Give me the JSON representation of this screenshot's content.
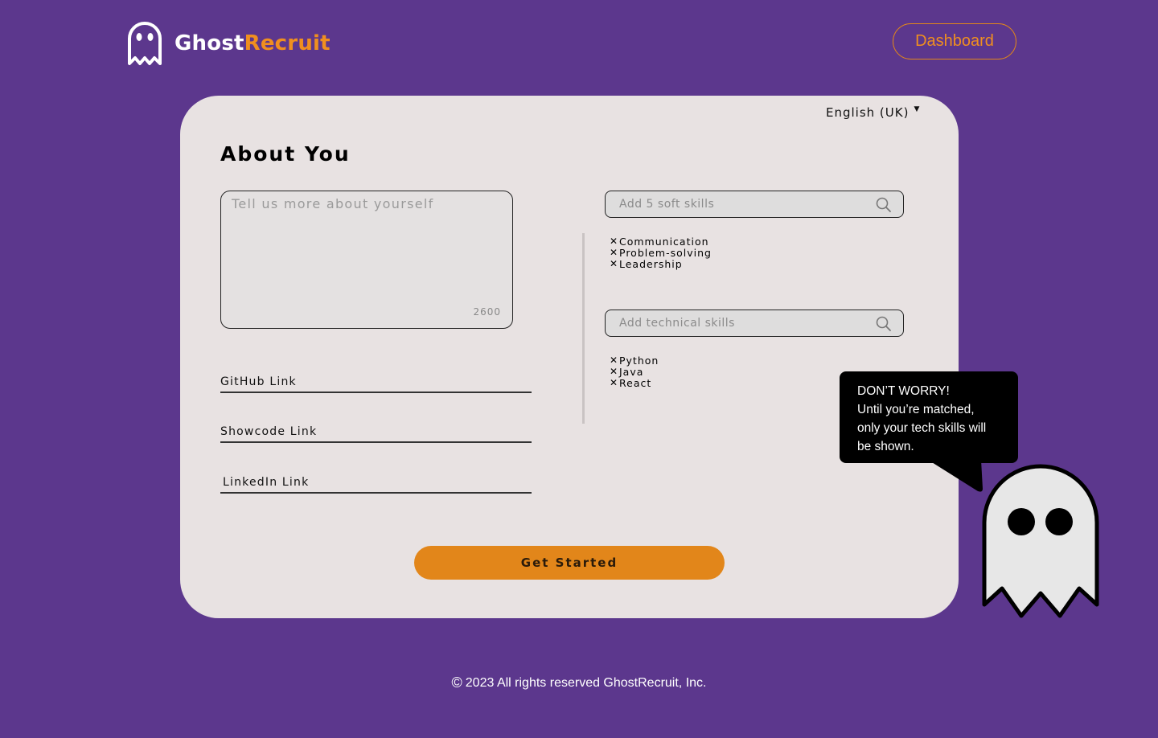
{
  "header": {
    "logo_word_1": "Ghost",
    "logo_word_2": "Recruit",
    "dashboard_label": "Dashboard"
  },
  "card": {
    "language": "English (UK)",
    "title": "About You",
    "about_placeholder": "Tell us more about yourself",
    "about_counter": "2600",
    "links": {
      "github": "GitHub Link",
      "showcode": "Showcode Link",
      "linkedin": "LinkedIn Link"
    },
    "soft_skills": {
      "placeholder": "Add 5 soft skills",
      "items": [
        "Communication",
        "Problem-solving",
        "Leadership"
      ]
    },
    "tech_skills": {
      "placeholder": "Add technical skills",
      "items": [
        "Python",
        "Java",
        "React"
      ]
    },
    "remove_glyph": "✕",
    "cta_label": "Get Started"
  },
  "tooltip": {
    "line_1": "DON’T WORRY!",
    "line_2": "Until you’re matched,",
    "line_3": "only your tech skills will",
    "line_4": "be shown."
  },
  "footer": {
    "copyright_symbol": "©",
    "text": "2023 All rights reserved GhostRecruit, Inc."
  },
  "colors": {
    "background": "#5c378d",
    "accent_orange": "#e2861a",
    "card": "#e8e2e2"
  },
  "icons": [
    "ghost-logo-icon",
    "caret-down-icon",
    "search-icon",
    "remove-icon",
    "ghost-mascot-icon",
    "copyright-icon"
  ]
}
